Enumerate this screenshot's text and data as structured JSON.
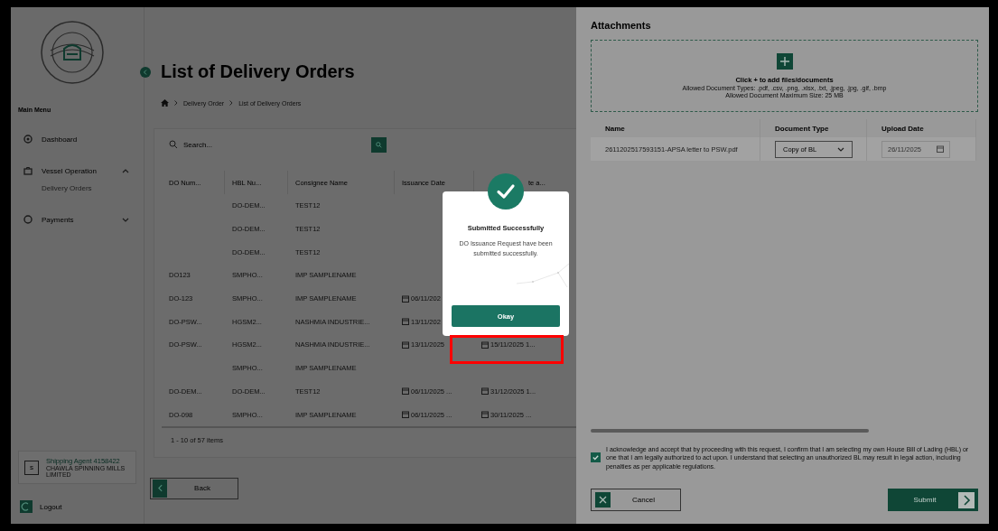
{
  "sidebar": {
    "menu_heading": "Main Menu",
    "items": [
      {
        "label": "Dashboard",
        "kind": "link"
      },
      {
        "label": "Vessel Operation",
        "kind": "group",
        "expanded": true,
        "children": [
          {
            "label": "Delivery Orders"
          }
        ]
      },
      {
        "label": "Payments",
        "kind": "group",
        "expanded": false
      }
    ],
    "user": {
      "avatar": "s",
      "name": "Shipping Agent 4158422",
      "company": "CHAWLA SPINNING MILLS LIMITED"
    },
    "logout": "Logout"
  },
  "page": {
    "title": "List of Delivery Orders",
    "breadcrumb": [
      "Delivery Order",
      "List of Delivery Orders"
    ]
  },
  "search": {
    "placeholder": "Search..."
  },
  "table": {
    "columns": [
      "DO Num...",
      "HBL Nu...",
      "Consignee Name",
      "Issuance Date",
      "te a..."
    ],
    "rows": [
      [
        "",
        "DO-DEM...",
        "TEST12",
        "",
        ""
      ],
      [
        "",
        "DO-DEM...",
        "TEST12",
        "",
        ""
      ],
      [
        "",
        "DO-DEM...",
        "TEST12",
        "",
        ""
      ],
      [
        "DO123",
        "SMPHO...",
        "IMP SAMPLENAME",
        "",
        ""
      ],
      [
        "DO-123",
        "SMPHO...",
        "IMP SAMPLENAME",
        "06/11/202",
        ""
      ],
      [
        "DO-PSW...",
        "HGSM2...",
        "NASHMIA INDUSTRIE...",
        "13/11/202",
        ""
      ],
      [
        "DO-PSW...",
        "HGSM2...",
        "NASHMIA INDUSTRIE...",
        "13/11/2025",
        "15/11/2025 1..."
      ],
      [
        "",
        "SMPHO...",
        "IMP SAMPLENAME",
        "",
        ""
      ],
      [
        "DO-DEM...",
        "DO-DEM...",
        "TEST12",
        "06/11/2025 ...",
        "31/12/2025 1..."
      ],
      [
        "DO-098",
        "SMPHO...",
        "IMP SAMPLENAME",
        "06/11/2025 ...",
        "30/11/2025 ..."
      ]
    ]
  },
  "pagination": "1 - 10 of 57 items",
  "back_button": "Back",
  "dialog": {
    "title": "Submitted Successfully",
    "message": "DO Issuance Request have been submitted successfully.",
    "button": "Okay"
  },
  "attachments": {
    "title": "Attachments",
    "dropzone": {
      "heading": "Click + to add files/documents",
      "types": "Allowed Document Types: .pdf, .csv, .png, .xlsx, .txt, .jpeg, .jpg, .gif, .bmp",
      "size": "Allowed Document Maximum Size: 25 MB"
    },
    "columns": [
      "Name",
      "Document Type",
      "Upload Date"
    ],
    "rows": [
      {
        "name": "2611202517593151-APSA letter to PSW.pdf",
        "document_type": "Copy of BL",
        "upload_date": "26/11/2025",
        "date_disabled": true
      }
    ]
  },
  "acknowledgement": {
    "checked": true,
    "text": "I acknowledge and accept that by proceeding with this request, I confirm that I am selecting my own House Bill of Lading (HBL) or one that I am legally authorized to act upon. I understand that selecting an unauthorized BL may result in legal action, including penalties as per applicable regulations."
  },
  "cancel_button": "Cancel",
  "submit_button": "Submit"
}
